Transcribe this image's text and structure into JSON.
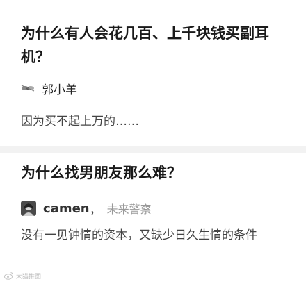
{
  "posts": [
    {
      "question": "为什么有人会花几百、上千块钱买副耳机？",
      "author": {
        "name": "郭小羊",
        "bio": ""
      },
      "answer": "因为买不起上万的……"
    },
    {
      "question": "为什么找男朋友那么难？",
      "author": {
        "name": "camen",
        "separator": "，",
        "bio": "未来警察"
      },
      "answer": "没有一见钟情的资本，又缺少日久生情的条件"
    }
  ],
  "watermark": {
    "text": "大猫推图",
    "icon": "weibo-icon"
  }
}
